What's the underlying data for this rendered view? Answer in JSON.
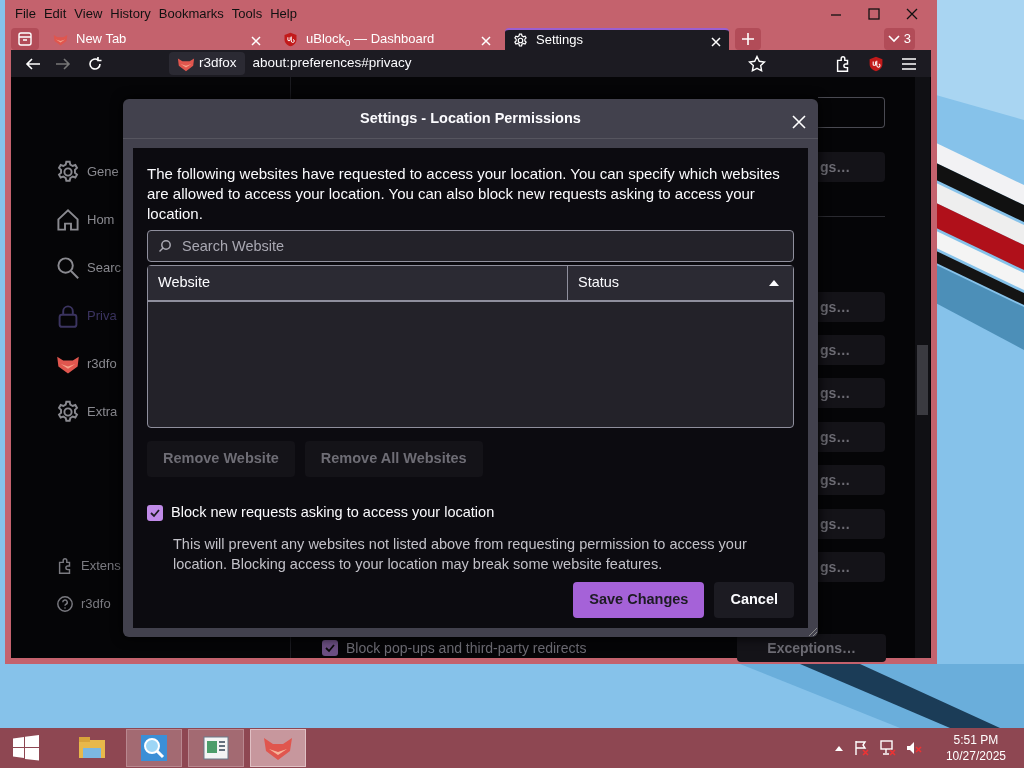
{
  "menu_bar": [
    "File",
    "Edit",
    "View",
    "History",
    "Bookmarks",
    "Tools",
    "Help"
  ],
  "tabs": [
    {
      "label": "New Tab",
      "kind": "fox",
      "selected": false
    },
    {
      "label": "uBlock$_{0}$ — Dashboard",
      "kind": "ublock",
      "selected": false
    },
    {
      "label": "Settings",
      "kind": "gear",
      "selected": true
    }
  ],
  "tab_overflow": {
    "count": "3"
  },
  "nav_bar": {
    "identity": "r3dfox",
    "url": "about:preferences#privacy"
  },
  "sidebar": {
    "items": [
      {
        "label": "Gene",
        "kind": "gear",
        "selected": false
      },
      {
        "label": "Hom",
        "kind": "home",
        "selected": false
      },
      {
        "label": "Searc",
        "kind": "search",
        "selected": false
      },
      {
        "label": "Priva",
        "kind": "lock",
        "selected": true
      },
      {
        "label": "r3dfo",
        "kind": "fox",
        "selected": false
      },
      {
        "label": "Extra",
        "kind": "gear",
        "selected": false
      }
    ],
    "footer": [
      {
        "label": "Extens",
        "kind": "puzzle"
      },
      {
        "label": "r3dfo",
        "kind": "help"
      }
    ]
  },
  "settings_buttons": [
    "gs…",
    "gs…",
    "gs…",
    "gs…",
    "gs…",
    "gs…",
    "gs…",
    "gs…"
  ],
  "popup_row": {
    "label": "Block pop-ups and third-party redirects",
    "checked": true,
    "button": "Exceptions…"
  },
  "dialog": {
    "title": "Settings - Location Permissions",
    "description": "The following websites have requested to access your location. You can specify which websites are allowed to access your location. You can also block new requests asking to access your location.",
    "search": {
      "placeholder": "Search Website"
    },
    "columns": [
      {
        "label": "Website",
        "sorted": false
      },
      {
        "label": "Status",
        "sorted": true
      }
    ],
    "list_buttons": [
      {
        "label": "Remove Website",
        "disabled": true
      },
      {
        "label": "Remove All Websites",
        "disabled": true
      }
    ],
    "block_checkbox": {
      "label": "Block new requests asking to access your location",
      "checked": true
    },
    "note": "This will prevent any websites not listed above from requesting permission to access your location. Blocking access to your location may break some website features.",
    "actions": [
      {
        "label": "Save Changes",
        "kind": "primary"
      },
      {
        "label": "Cancel",
        "kind": "secondary"
      }
    ]
  },
  "taskbar": {
    "apps": [
      {
        "kind": "folder",
        "running": false,
        "active": false
      },
      {
        "kind": "magnifier",
        "running": true,
        "active": false
      },
      {
        "kind": "document",
        "running": true,
        "active": false
      },
      {
        "kind": "fox",
        "running": true,
        "active": true
      }
    ],
    "time": "5:51 PM",
    "date": "10/27/2025"
  }
}
